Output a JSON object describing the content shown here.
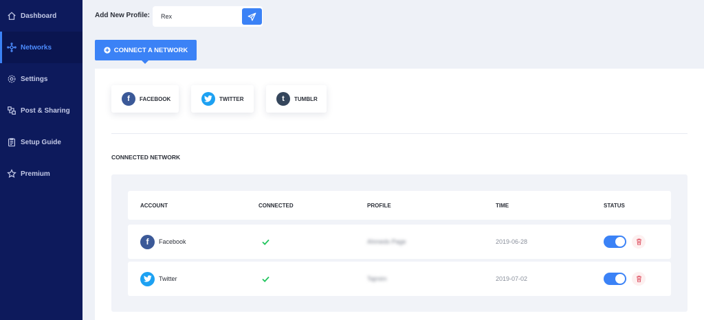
{
  "sidebar": {
    "items": [
      {
        "label": "Dashboard",
        "icon": "home-icon",
        "active": false
      },
      {
        "label": "Networks",
        "icon": "network-icon",
        "active": true
      },
      {
        "label": "Settings",
        "icon": "gear-icon",
        "active": false
      },
      {
        "label": "Post & Sharing",
        "icon": "share-icon",
        "active": false
      },
      {
        "label": "Setup Guide",
        "icon": "clipboard-icon",
        "active": false
      },
      {
        "label": "Premium",
        "icon": "star-icon",
        "active": false
      }
    ]
  },
  "profile": {
    "label": "Add New Profile:",
    "value": "Rex",
    "submit_icon": "paper-plane-icon"
  },
  "connect_button": {
    "label": "CONNECT A NETWORK",
    "icon": "plus-circle-icon"
  },
  "networks": [
    {
      "label": "FACEBOOK",
      "icon": "facebook-icon",
      "color": "#3b5998"
    },
    {
      "label": "TWITTER",
      "icon": "twitter-icon",
      "color": "#1da1f2"
    },
    {
      "label": "TUMBLR",
      "icon": "tumblr-icon",
      "color": "#35465c"
    }
  ],
  "connected_title": "CONNECTED NETWORK",
  "table": {
    "headers": [
      "ACCOUNT",
      "CONNECTED",
      "PROFILE",
      "TIME",
      "STATUS"
    ],
    "rows": [
      {
        "account": "Facebook",
        "icon": "facebook-icon",
        "connected": true,
        "profile": "Ahmeds Page",
        "time": "2019-06-28",
        "status_on": true
      },
      {
        "account": "Twitter",
        "icon": "twitter-icon",
        "connected": true,
        "profile": "Tajmim",
        "time": "2019-07-02",
        "status_on": true
      }
    ]
  },
  "colors": {
    "sidebar": "#0d1a5c",
    "accent": "#3b82f6",
    "check": "#22c55e",
    "delete": "#e05a6a"
  }
}
